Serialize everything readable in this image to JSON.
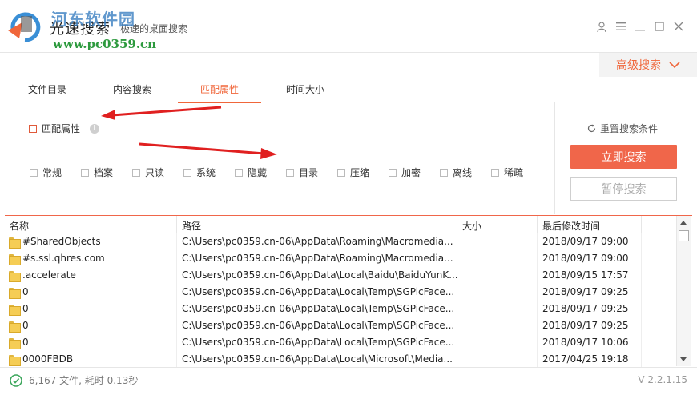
{
  "titlebar": {
    "title": "光速搜索",
    "subtitle": "极速的桌面搜索",
    "watermark_title": "河东软件园",
    "watermark_url": "www.pc0359.cn"
  },
  "advanced": {
    "label": "高级搜索"
  },
  "tabs": [
    {
      "label": "文件目录",
      "active": false
    },
    {
      "label": "内容搜索",
      "active": false
    },
    {
      "label": "匹配属性",
      "active": true
    },
    {
      "label": "时间大小",
      "active": false
    }
  ],
  "match": {
    "label": "匹配属性"
  },
  "attributes": [
    "常规",
    "档案",
    "只读",
    "系统",
    "隐藏",
    "目录",
    "压缩",
    "加密",
    "离线",
    "稀疏"
  ],
  "side": {
    "reset_label": "重置搜索条件",
    "search_label": "立即搜索",
    "pause_label": "暂停搜索"
  },
  "table": {
    "headers": [
      "名称",
      "路径",
      "大小",
      "最后修改时间"
    ],
    "rows": [
      {
        "name": "#SharedObjects",
        "path": "C:\\Users\\pc0359.cn-06\\AppData\\Roaming\\Macromedia...",
        "size": "",
        "time": "2018/09/17 09:00"
      },
      {
        "name": "#s.ssl.qhres.com",
        "path": "C:\\Users\\pc0359.cn-06\\AppData\\Roaming\\Macromedia...",
        "size": "",
        "time": "2018/09/17 09:00"
      },
      {
        "name": ".accelerate",
        "path": "C:\\Users\\pc0359.cn-06\\AppData\\Local\\Baidu\\BaiduYunK...",
        "size": "",
        "time": "2018/09/15 17:57"
      },
      {
        "name": "0",
        "path": "C:\\Users\\pc0359.cn-06\\AppData\\Local\\Temp\\SGPicFace...",
        "size": "",
        "time": "2018/09/17 09:25"
      },
      {
        "name": "0",
        "path": "C:\\Users\\pc0359.cn-06\\AppData\\Local\\Temp\\SGPicFace...",
        "size": "",
        "time": "2018/09/17 09:25"
      },
      {
        "name": "0",
        "path": "C:\\Users\\pc0359.cn-06\\AppData\\Local\\Temp\\SGPicFace...",
        "size": "",
        "time": "2018/09/17 09:25"
      },
      {
        "name": "0",
        "path": "C:\\Users\\pc0359.cn-06\\AppData\\Local\\Temp\\SGPicFace...",
        "size": "",
        "time": "2018/09/17 10:06"
      },
      {
        "name": "0000FBDB",
        "path": "C:\\Users\\pc0359.cn-06\\AppData\\Local\\Microsoft\\Media...",
        "size": "",
        "time": "2017/04/25 19:18"
      }
    ]
  },
  "status": {
    "summary": "6,167 文件, 耗时 0.13秒",
    "version": "V 2.2.1.15"
  },
  "colors": {
    "accent": "#f0664a",
    "arrow": "#e02020"
  }
}
